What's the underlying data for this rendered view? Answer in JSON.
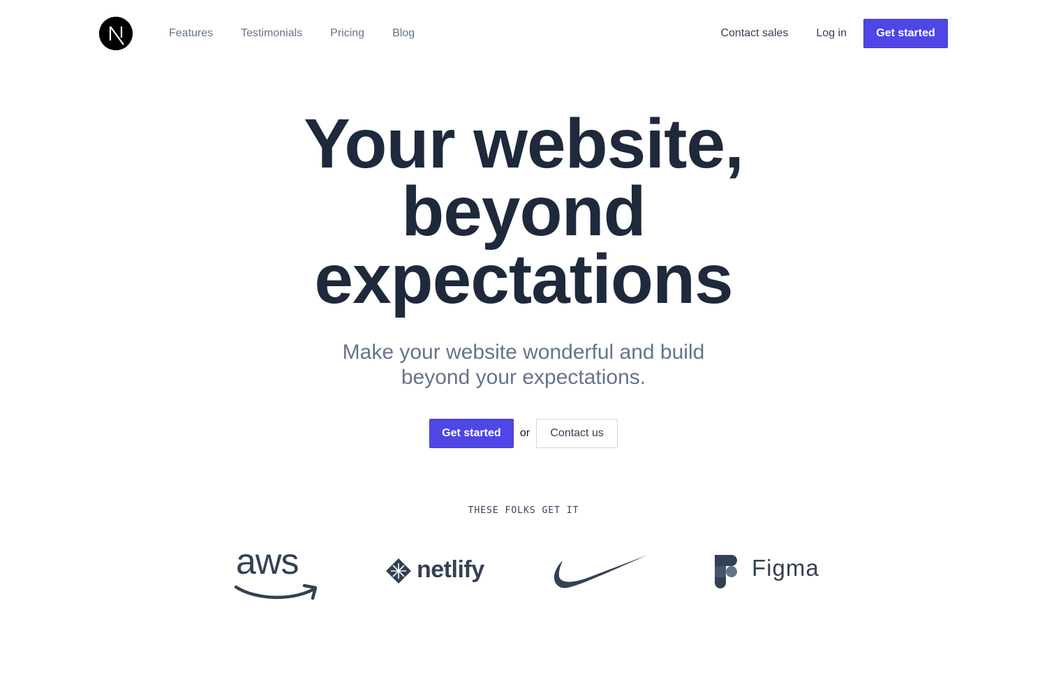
{
  "header": {
    "logo_icon": "nextjs-logo-icon",
    "nav": [
      "Features",
      "Testimonials",
      "Pricing",
      "Blog"
    ],
    "contact_sales": "Contact sales",
    "login": "Log in",
    "get_started": "Get started"
  },
  "hero": {
    "title_lines": [
      "Your website,",
      "beyond",
      "expectations"
    ],
    "subtitle_lines": [
      "Make your website wonderful and build",
      "beyond your expectations."
    ],
    "cta_primary": "Get started",
    "cta_or": "or",
    "cta_secondary": "Contact us"
  },
  "social_proof": {
    "heading": "THESE FOLKS GET IT",
    "brands": [
      {
        "name": "aws",
        "icon": "aws-logo-icon"
      },
      {
        "name": "netlify",
        "icon": "netlify-logo-icon"
      },
      {
        "name": "",
        "icon": "nike-logo-icon"
      },
      {
        "name": "Figma",
        "icon": "figma-logo-icon"
      }
    ]
  },
  "colors": {
    "accent": "#4f46e5",
    "heading": "#1e293b",
    "muted": "#64748b",
    "logo": "#334155"
  }
}
